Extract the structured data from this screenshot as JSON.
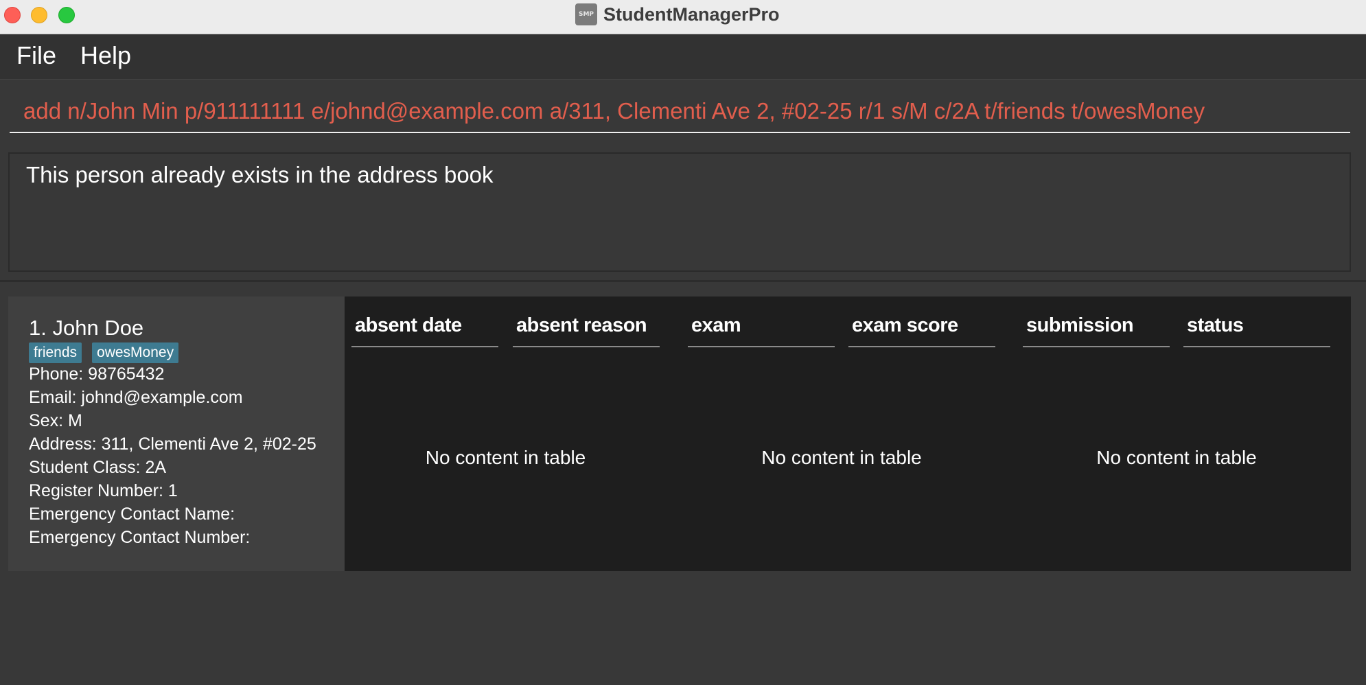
{
  "window": {
    "title": "StudentManagerPro",
    "icon_text": "SMP"
  },
  "menu": {
    "file_label": "File",
    "help_label": "Help"
  },
  "command": {
    "value": "add n/John Min p/911111111 e/johnd@example.com a/311, Clementi Ave 2, #02-25 r/1 s/M c/2A t/friends t/owesMoney",
    "color": "#e25e4d"
  },
  "result": {
    "message": "This person already exists in the address book"
  },
  "person": {
    "name": "1. John Doe",
    "tags": [
      "friends",
      "owesMoney"
    ],
    "phone": "Phone: 98765432",
    "email": "Email: johnd@example.com",
    "sex": "Sex: M",
    "address": "Address: 311, Clementi Ave 2, #02-25",
    "student_class": "Student Class: 2A",
    "register_number": "Register Number: 1",
    "emergency_name": "Emergency Contact Name:",
    "emergency_number": "Emergency Contact Number:",
    "tag_color": "#3e7b91"
  },
  "tables": [
    {
      "columns": [
        "absent date",
        "absent reason"
      ],
      "empty_text": "No content in table"
    },
    {
      "columns": [
        "exam",
        "exam score"
      ],
      "empty_text": "No content in table"
    },
    {
      "columns": [
        "submission",
        "status"
      ],
      "empty_text": "No content in table"
    }
  ]
}
